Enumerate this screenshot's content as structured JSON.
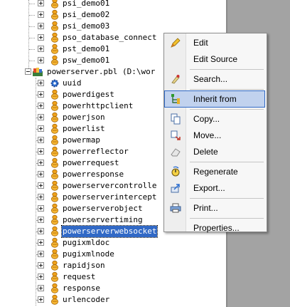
{
  "tree": {
    "above_items": [
      "psi_demo01",
      "psi_demo02",
      "psi_demo03",
      "pso_database_connect",
      "pst_demo01",
      "psw_demo01"
    ],
    "library_label": "powerserver.pbl (D:\\wor",
    "children": [
      {
        "label": "uuid",
        "icon": "gear-icon"
      },
      {
        "label": "powerdigest",
        "icon": "nvo-object-icon"
      },
      {
        "label": "powerhttpclient",
        "icon": "nvo-object-icon"
      },
      {
        "label": "powerjson",
        "icon": "nvo-object-icon"
      },
      {
        "label": "powerlist",
        "icon": "nvo-object-icon"
      },
      {
        "label": "powermap",
        "icon": "nvo-object-icon"
      },
      {
        "label": "powerreflector",
        "icon": "nvo-object-icon"
      },
      {
        "label": "powerrequest",
        "icon": "nvo-object-icon"
      },
      {
        "label": "powerresponse",
        "icon": "nvo-object-icon"
      },
      {
        "label": "powerservercontrolle",
        "icon": "nvo-object-icon"
      },
      {
        "label": "powerserverintercept",
        "icon": "nvo-object-icon"
      },
      {
        "label": "powerserverobject",
        "icon": "nvo-object-icon"
      },
      {
        "label": "powerservertiming",
        "icon": "nvo-object-icon"
      },
      {
        "label": "powerserverwebsocket",
        "icon": "nvo-object-icon",
        "selected": true
      },
      {
        "label": "pugixmldoc",
        "icon": "nvo-object-icon"
      },
      {
        "label": "pugixmlnode",
        "icon": "nvo-object-icon"
      },
      {
        "label": "rapidjson",
        "icon": "nvo-object-icon"
      },
      {
        "label": "request",
        "icon": "nvo-object-icon"
      },
      {
        "label": "response",
        "icon": "nvo-object-icon"
      },
      {
        "label": "urlencoder",
        "icon": "nvo-object-icon"
      }
    ]
  },
  "context_menu": {
    "items": [
      {
        "label": "Edit",
        "icon": "edit-icon",
        "name": "menu-item-edit"
      },
      {
        "label": "Edit Source",
        "icon": "",
        "name": "menu-item-edit-source"
      },
      {
        "sep": true
      },
      {
        "label": "Search...",
        "icon": "search-icon",
        "name": "menu-item-search"
      },
      {
        "sep": true
      },
      {
        "label": "Inherit from",
        "icon": "inherit-icon",
        "name": "menu-item-inherit-from",
        "highlighted": true
      },
      {
        "sep": true
      },
      {
        "label": "Copy...",
        "icon": "copy-icon",
        "name": "menu-item-copy"
      },
      {
        "label": "Move...",
        "icon": "move-icon",
        "name": "menu-item-move"
      },
      {
        "label": "Delete",
        "icon": "eraser-icon",
        "name": "menu-item-delete"
      },
      {
        "sep": true
      },
      {
        "label": "Regenerate",
        "icon": "regenerate-icon",
        "name": "menu-item-regenerate"
      },
      {
        "label": "Export...",
        "icon": "export-icon",
        "name": "menu-item-export"
      },
      {
        "sep": true
      },
      {
        "label": "Print...",
        "icon": "print-icon",
        "name": "menu-item-print"
      },
      {
        "sep": true
      },
      {
        "label": "Properties...",
        "icon": "",
        "name": "menu-item-properties"
      }
    ]
  },
  "colors": {
    "selection": "#3169c6",
    "menu_highlight": "#c1d2ee",
    "scroll_area": "#a3a3a3"
  }
}
